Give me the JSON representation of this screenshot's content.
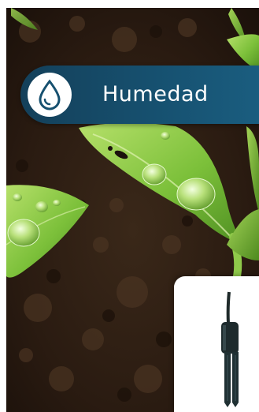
{
  "badge": {
    "label": "Humedad",
    "icon": "water-drop-icon",
    "accent_color": "#16506f"
  },
  "product": {
    "icon": "soil-moisture-probe-icon"
  }
}
